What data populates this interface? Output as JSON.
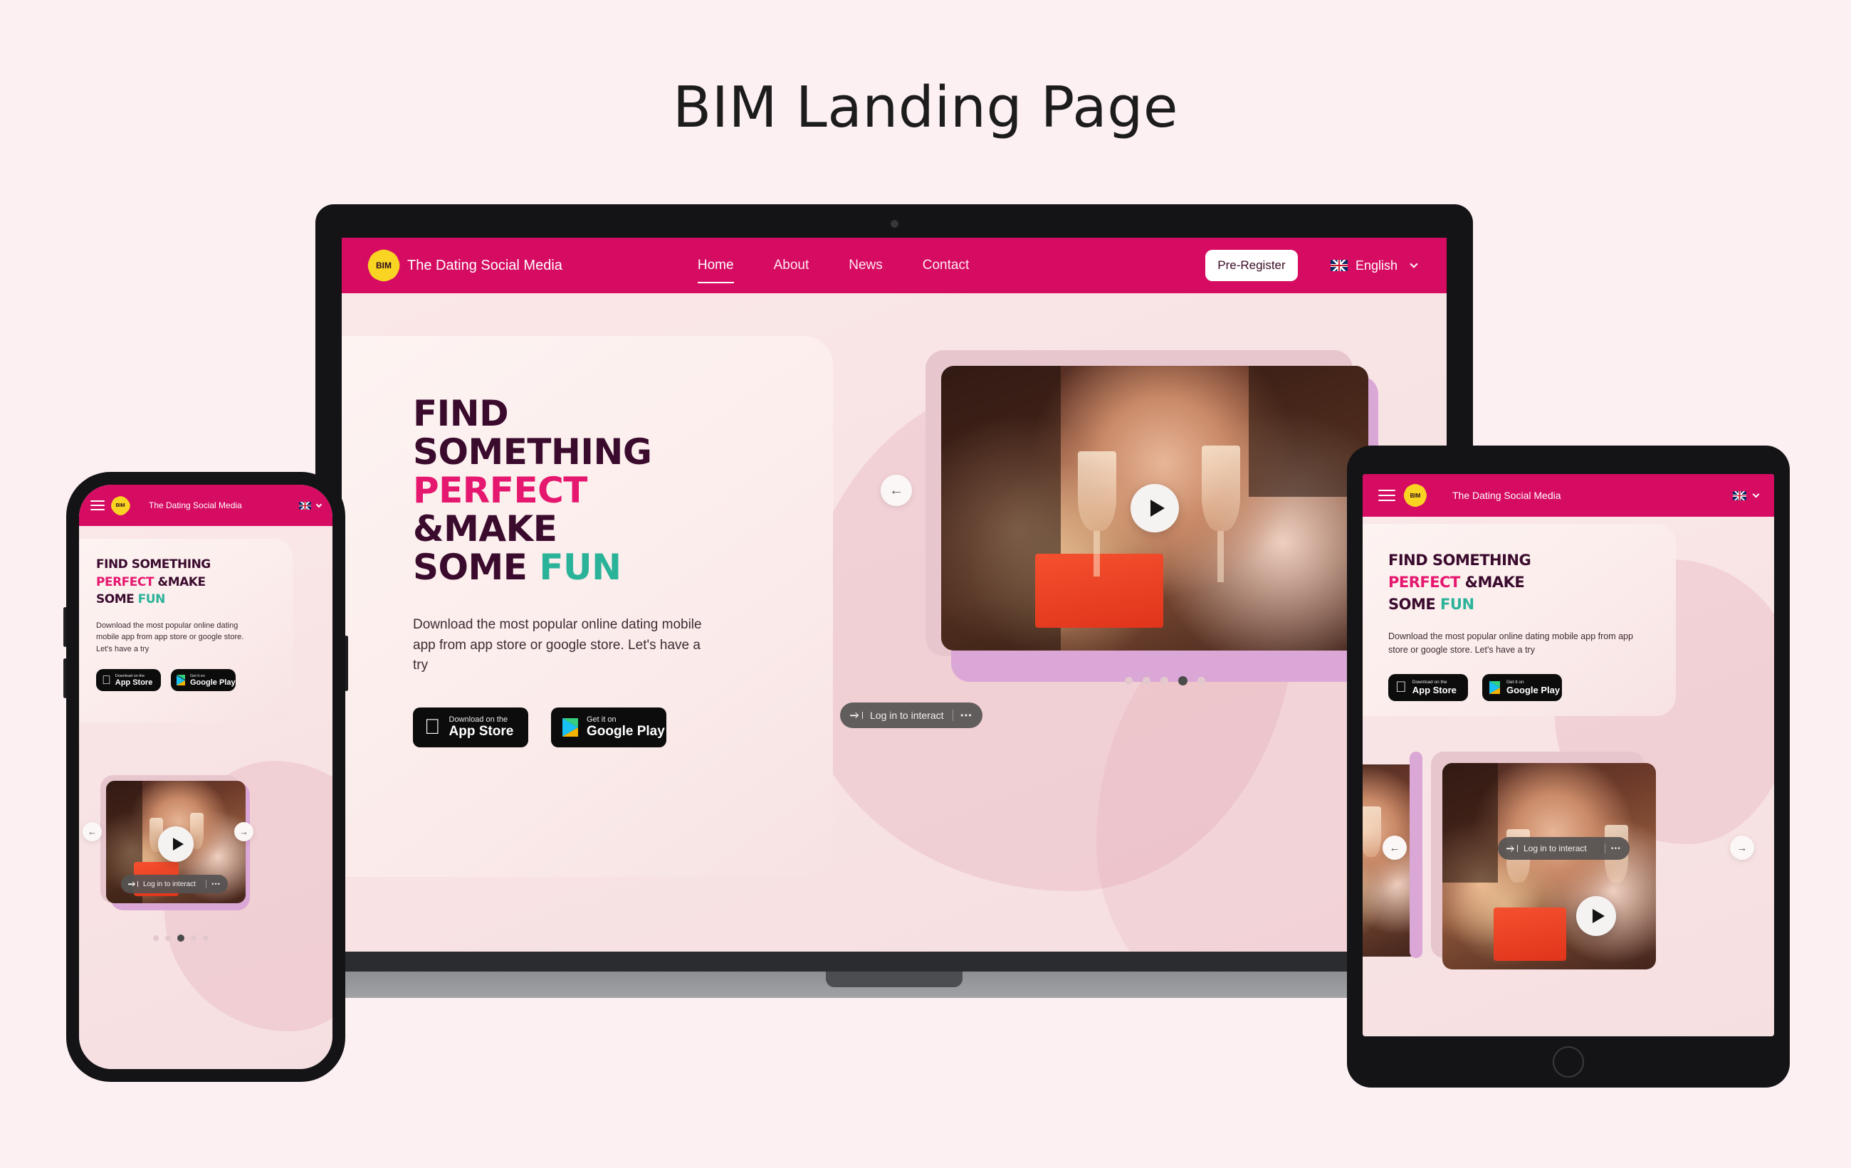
{
  "page": {
    "title": "BIM Landing Page",
    "background_color": "#fdf0f3"
  },
  "colors": {
    "brand_pink": "#d60b62",
    "accent_pink": "#e5176f",
    "accent_teal": "#2bb39a",
    "heading_dark": "#3b0b2e",
    "logo_yellow": "#f9d423"
  },
  "site": {
    "logo_text": "BIM",
    "brand_name": "The Dating Social Media",
    "nav": [
      {
        "label": "Home",
        "active": true
      },
      {
        "label": "About",
        "active": false
      },
      {
        "label": "News",
        "active": false
      },
      {
        "label": "Contact",
        "active": false
      }
    ],
    "cta_label": "Pre-Register",
    "language": "English",
    "hero": {
      "line1": "FIND",
      "line2": "SOMETHING",
      "line3_pink": "PERFECT",
      "line4": "&MAKE",
      "line5": "SOME",
      "line5_teal": "FUN",
      "mobile_line1": "FIND SOMETHING",
      "mobile_line2_pink": "PERFECT",
      "mobile_line2_rest": "&MAKE",
      "mobile_line3": "SOME",
      "mobile_line3_teal": "FUN",
      "paragraph": "Download the most popular online dating mobile app from app store or google store. Let's have a try"
    },
    "stores": [
      {
        "sub": "Download on the",
        "main": "App Store",
        "icon": "apple-icon"
      },
      {
        "sub": "Get it on",
        "main": "Google Play",
        "icon": "google-play-icon"
      }
    ],
    "video": {
      "overlay_label": "Log in to interact",
      "overlay_menu": "•••",
      "play_label": "Play"
    },
    "carousel": {
      "prev_label": "←",
      "next_label": "→",
      "desktop_dots": 5,
      "desktop_active": 4,
      "mobile_dots": 5,
      "mobile_active": 3
    }
  }
}
